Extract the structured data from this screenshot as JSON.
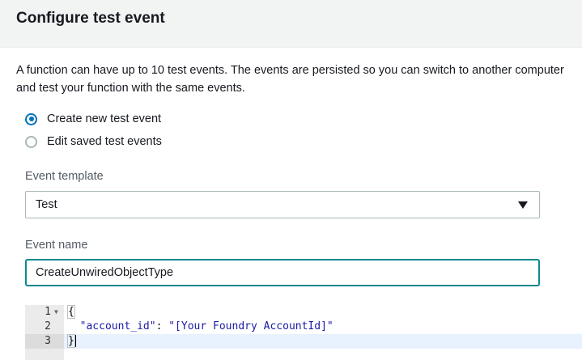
{
  "header": {
    "title": "Configure test event"
  },
  "description": {
    "line1": "A function can have up to 10 test events. The events are persisted so you can switch to another computer",
    "line2": "and test your function with the same events."
  },
  "mode_options": [
    {
      "label": "Create new test event",
      "selected": true
    },
    {
      "label": "Edit saved test events",
      "selected": false
    }
  ],
  "event_template": {
    "label": "Event template",
    "value": "Test"
  },
  "event_name": {
    "label": "Event name",
    "value": "CreateUnwiredObjectType"
  },
  "editor": {
    "lines": [
      {
        "number": "1",
        "text": "{"
      },
      {
        "number": "2",
        "key": "\"account_id\"",
        "sep": ": ",
        "value": "\"[Your Foundry AccountId]\""
      },
      {
        "number": "3",
        "text": "}"
      }
    ],
    "colors": {
      "gutter": "#ebebeb",
      "active_line": "#e8f2fe",
      "string": "#1a1aa6"
    }
  },
  "colors": {
    "accent": "#0073bb",
    "focus_border": "#0a8a8d",
    "header_bg": "#f2f3f3"
  }
}
